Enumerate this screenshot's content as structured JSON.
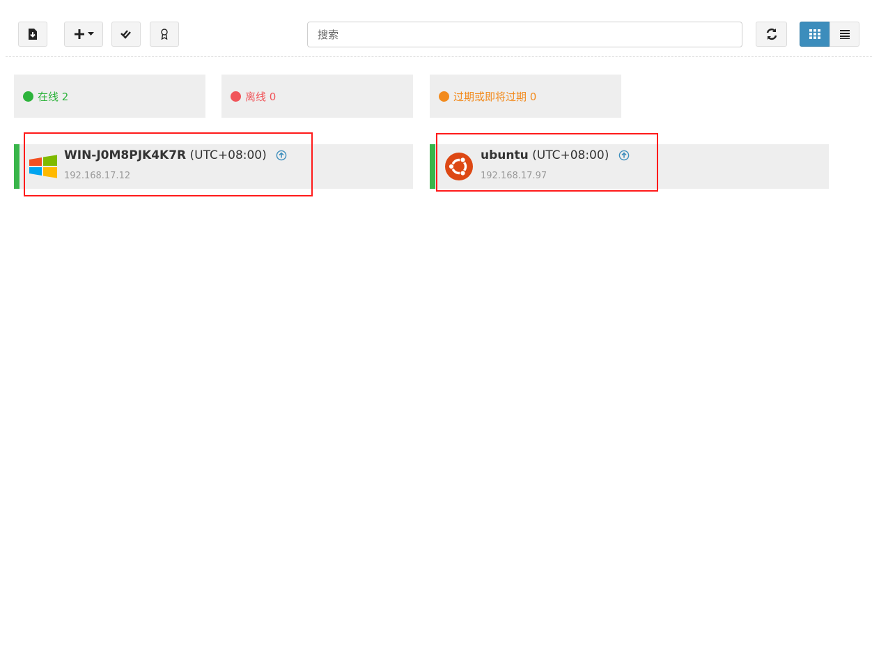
{
  "toolbar": {
    "search_placeholder": "搜索",
    "icons": [
      "import-icon",
      "add-icon",
      "caret-down-icon",
      "check-all-icon",
      "license-icon",
      "refresh-icon",
      "grid-view-icon",
      "list-view-icon"
    ]
  },
  "status": {
    "online_label": "在线 2",
    "offline_label": "离线 0",
    "expired_label": "过期或即将过期 0",
    "colors": {
      "online": "#2db33b",
      "offline": "#f0555a",
      "expired": "#f28b1e"
    }
  },
  "hosts": [
    {
      "name": "WIN-J0M8PJK4K7R",
      "timezone": "(UTC+08:00)",
      "ip": "192.168.17.12",
      "os": "windows"
    },
    {
      "name": "ubuntu",
      "timezone": "(UTC+08:00)",
      "ip": "192.168.17.97",
      "os": "ubuntu"
    }
  ],
  "colors": {
    "accent": "#3c8dbc",
    "status_bar": "#39b54a",
    "highlight": "#ff1a1a"
  }
}
